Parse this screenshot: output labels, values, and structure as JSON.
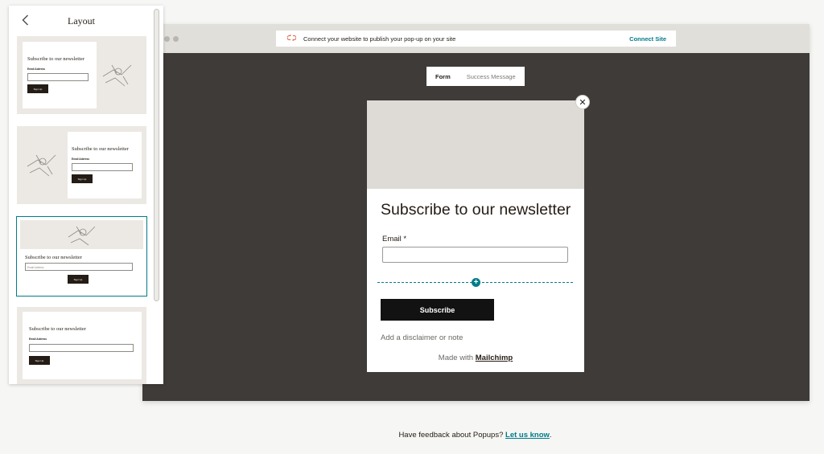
{
  "panel": {
    "title": "Layout",
    "back_icon": "chevron-left-icon",
    "layouts": [
      {
        "title": "Subscribe to our newsletter",
        "field_label": "Email Address",
        "button": "Sign Up",
        "selected": false
      },
      {
        "title": "Subscribe to our newsletter",
        "field_label": "Email Address",
        "button": "Sign Up",
        "selected": false
      },
      {
        "title": "Subscribe to our newsletter",
        "field_placeholder": "Email Address",
        "button": "Sign Up",
        "selected": true
      },
      {
        "title": "Subscribe to our newsletter",
        "field_label": "Email Address",
        "button": "Sign Up",
        "selected": false
      }
    ]
  },
  "browser": {
    "notice": {
      "icon": "broken-link-icon",
      "message": "Connect your website to publish your pop-up on your site",
      "action": "Connect Site"
    },
    "tabs": [
      {
        "label": "Form",
        "active": true
      },
      {
        "label": "Success Message",
        "active": false
      }
    ],
    "popup": {
      "title": "Subscribe to our newsletter",
      "email_label": "Email *",
      "email_value": "",
      "subscribe_label": "Subscribe",
      "disclaimer_placeholder": "Add a disclaimer or note",
      "made_with_prefix": "Made with",
      "made_with_brand": "Mailchimp",
      "close_icon": "close-icon",
      "add_icon": "plus-icon"
    }
  },
  "footer": {
    "text": "Have feedback about Popups?",
    "link": "Let us know",
    "suffix": "."
  },
  "colors": {
    "accent": "#007c89",
    "canvas": "#3f3b38",
    "hero": "#dedbd6",
    "button": "#121212"
  }
}
